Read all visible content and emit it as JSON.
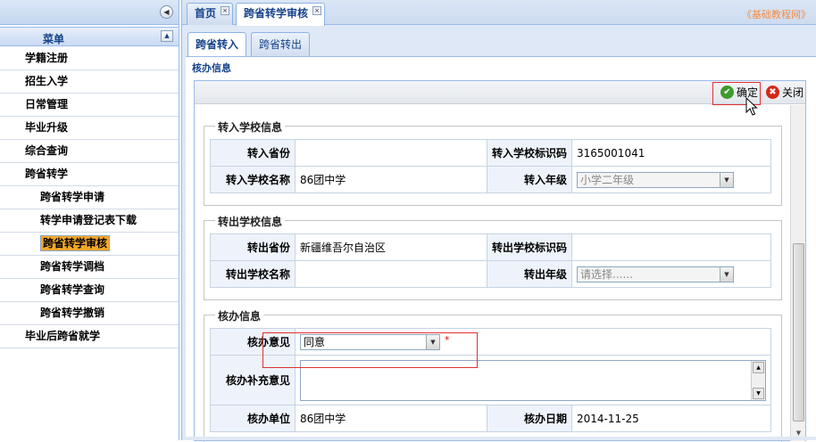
{
  "sidebar": {
    "collapse_glyph": "◀",
    "menu_title": "菜单",
    "menu_toggle_glyph": "▲",
    "items": [
      {
        "label": "学籍注册"
      },
      {
        "label": "招生入学"
      },
      {
        "label": "日常管理"
      },
      {
        "label": "毕业升级"
      },
      {
        "label": "综合查询"
      },
      {
        "label": "跨省转学"
      }
    ],
    "subitems": [
      {
        "label": "跨省转学申请"
      },
      {
        "label": "转学申请登记表下载"
      },
      {
        "label": "跨省转学审核",
        "selected": true
      },
      {
        "label": "跨省转学调档"
      },
      {
        "label": "跨省转学查询"
      },
      {
        "label": "跨省转学撤销"
      }
    ],
    "last_item": "毕业后跨省就学"
  },
  "tabs": [
    {
      "label": "首页"
    },
    {
      "label": "跨省转学审核",
      "active": true
    }
  ],
  "tab_close_glyph": "×",
  "site_link": "《基础教程网》",
  "subtabs": [
    {
      "label": "跨省转入",
      "active": true
    },
    {
      "label": "跨省转出"
    }
  ],
  "section_title": "核办信息",
  "toolbar": {
    "confirm_label": "确定",
    "close_label": "关闭",
    "confirm_icon": "✔",
    "close_icon": "✖"
  },
  "transfer_in": {
    "legend": "转入学校信息",
    "province_label": "转入省份",
    "province_value": "",
    "school_code_label": "转入学校标识码",
    "school_code_value": "3165001041",
    "school_name_label": "转入学校名称",
    "school_name_value": "86团中学",
    "grade_label": "转入年级",
    "grade_value": "小学二年级"
  },
  "transfer_out": {
    "legend": "转出学校信息",
    "province_label": "转出省份",
    "province_value": "新疆维吾尔自治区",
    "school_code_label": "转出学校标识码",
    "school_code_value": "",
    "school_name_label": "转出学校名称",
    "school_name_value": "",
    "grade_label": "转出年级",
    "grade_placeholder": "请选择......"
  },
  "handling": {
    "legend": "核办信息",
    "opinion_label": "核办意见",
    "opinion_value": "同意",
    "required_mark": "*",
    "remark_label": "核办补充意见",
    "remark_value": "",
    "unit_label": "核办单位",
    "unit_value": "86团中学",
    "date_label": "核办日期",
    "date_value": "2014-11-25"
  },
  "icons": {
    "dropdown_arrow": "▼",
    "scroll_up": "▲",
    "scroll_down": "▼",
    "cursor_icon": "arrow-cursor-icon"
  }
}
